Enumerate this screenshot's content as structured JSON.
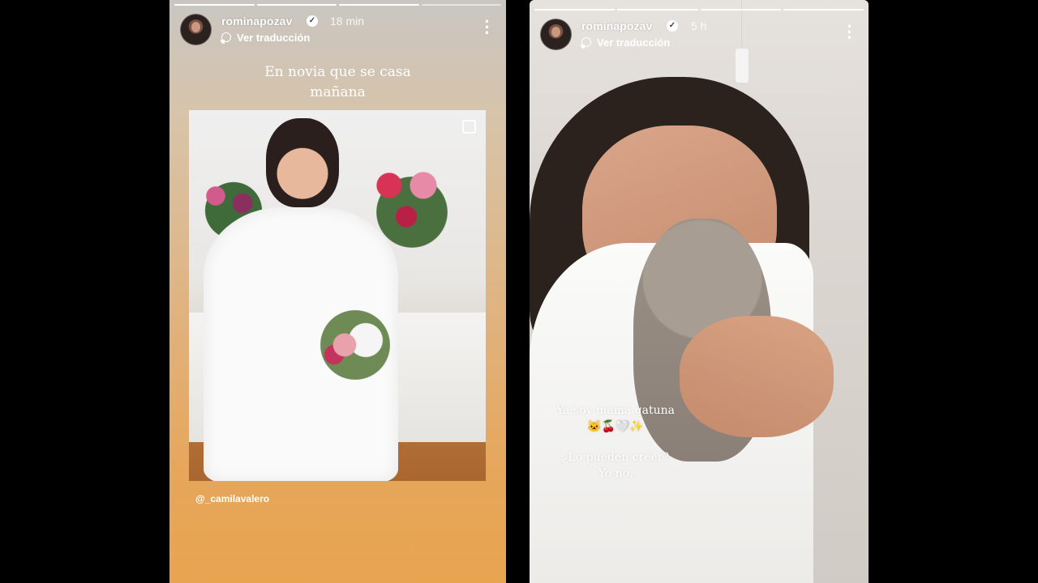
{
  "stories": [
    {
      "username": "rominapozav",
      "time_ago": "18 min",
      "translate_label": "Ver traducción",
      "caption_lines": [
        "En novia que se casa",
        "mañana"
      ],
      "mention": "@_camilavalero",
      "progress": {
        "segments": 4,
        "completed": 3
      }
    },
    {
      "username": "rominapozav",
      "time_ago": "5 h",
      "translate_label": "Ver traducción",
      "caption_lines": [
        "Ya soy mamá gatuna",
        "🐱🍒🤍✨",
        "",
        "¿Lo pueden creer?",
        "Yo no."
      ],
      "progress": {
        "segments": 4,
        "completed": 4
      }
    }
  ],
  "icons": {
    "verified": "verified-badge-icon",
    "more": "more-vertical-icon",
    "translate": "translate-icon"
  },
  "colors": {
    "story1_gradient_top": "#c9c6c2",
    "story1_gradient_bottom": "#e8a44f",
    "text": "#ffffff"
  }
}
